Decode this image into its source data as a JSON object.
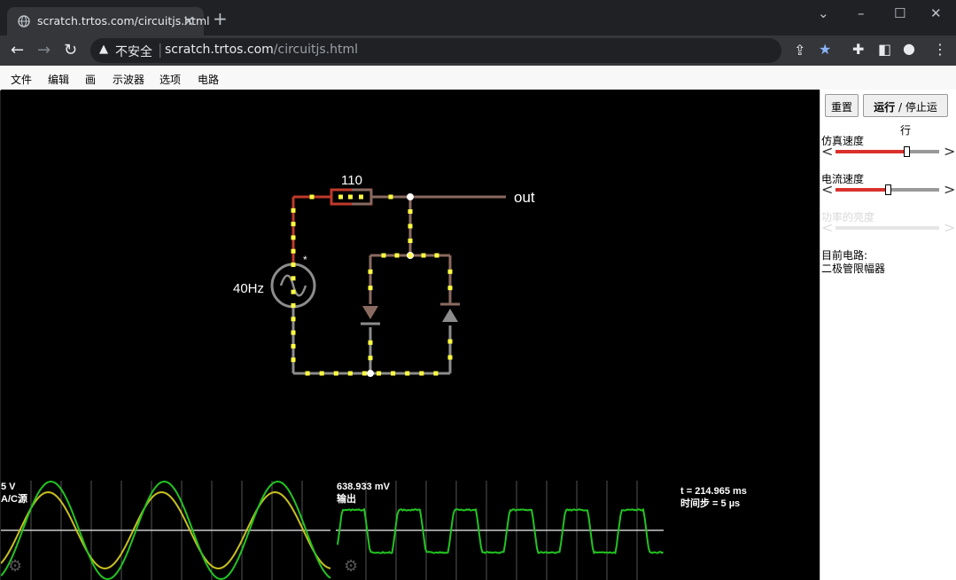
{
  "browser": {
    "tab_title": "scratch.trtos.com/circuitjs.html",
    "security_label": "不安全",
    "url_host": "scratch.trtos.com",
    "url_path": "/circuitjs.html"
  },
  "menu": {
    "file": "文件",
    "edit": "编辑",
    "draw": "画",
    "scopes": "示波器",
    "options": "选项",
    "circuits": "电路"
  },
  "sidebar": {
    "reset_label": "重置",
    "run_label_bold": "运行",
    "run_label_rest": " / 停止运行",
    "sim_speed_label": "仿真速度",
    "sim_speed_value": 0.68,
    "current_speed_label": "电流速度",
    "current_speed_value": 0.5,
    "power_brightness_label": "功率的亮度",
    "current_circuit_label": "目前电路:",
    "current_circuit_name": "二极管限幅器"
  },
  "circuit": {
    "resistor_value": "110",
    "source_frequency": "40Hz",
    "source_marker": "*",
    "output_label": "out"
  },
  "scopes": {
    "scope1_value": "5 V",
    "scope1_name": "A/C源",
    "scope2_value": "638.933 mV",
    "scope2_name": "输出",
    "time_readout": "t = 214.965 ms",
    "timestep_readout": "时间步 = 5 µs"
  },
  "colors": {
    "wire_gray": "#8c8c8c",
    "wire_red": "#c0392b",
    "wire_brown": "#8a6a60",
    "current_dot": "#ffff40",
    "trace_green": "#22c422",
    "trace_yellow": "#c8c020",
    "slider_fill": "#d9302c"
  }
}
